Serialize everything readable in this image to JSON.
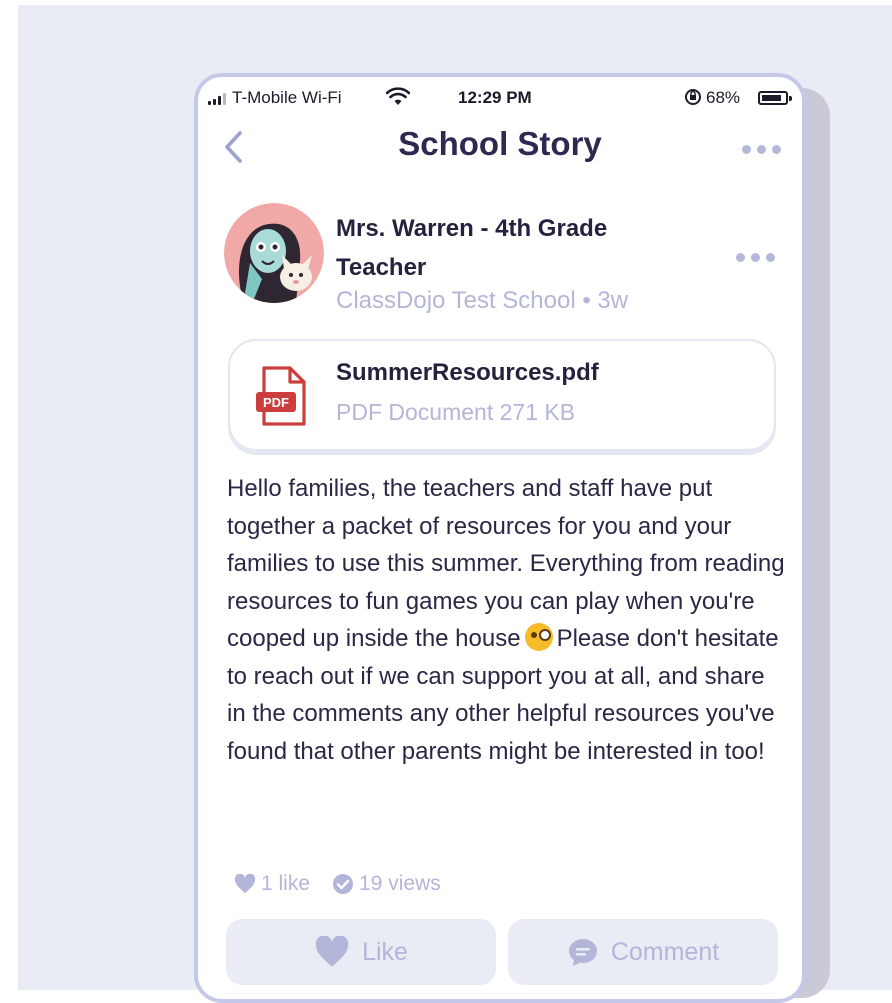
{
  "status_bar": {
    "carrier": "T-Mobile Wi-Fi",
    "time": "12:29 PM",
    "battery": "68%",
    "icons": [
      "signal-icon",
      "wifi-icon",
      "orientation-lock-icon",
      "battery-icon"
    ]
  },
  "nav": {
    "title": "School Story",
    "back_icon": "chevron-left-icon",
    "menu_icon": "more-dots-icon"
  },
  "post": {
    "author": "Mrs. Warren - 4th Grade Teacher",
    "meta": "ClassDojo Test School • 3w",
    "menu_icon": "more-dots-icon",
    "attachment": {
      "icon": "pdf-file-icon",
      "badge": "PDF",
      "name": "SummerResources.pdf",
      "info": "PDF Document 271 KB"
    },
    "body_before_emoji": "Hello families, the teachers and staff have put together a packet of resources for you and your families to use this summer. Everything from reading resources to fun games you can play when you're cooped up inside the house",
    "emoji": "winking-tongue-emoji",
    "body_after_emoji": "Please don't hesitate to reach out if we can support you at all, and share in the comments any other helpful resources you've found that other parents might be interested in too!",
    "likes": "1 like",
    "views": "19 views"
  },
  "actions": {
    "like_label": "Like",
    "comment_label": "Comment"
  },
  "colors": {
    "backdrop": "#e9ecf4",
    "phone_border": "#c5c8e8",
    "title_text": "#2c2a50",
    "muted_text": "#b3b5d9",
    "button_bg": "#e9ebf5",
    "pdf_red": "#cc3d3d"
  }
}
